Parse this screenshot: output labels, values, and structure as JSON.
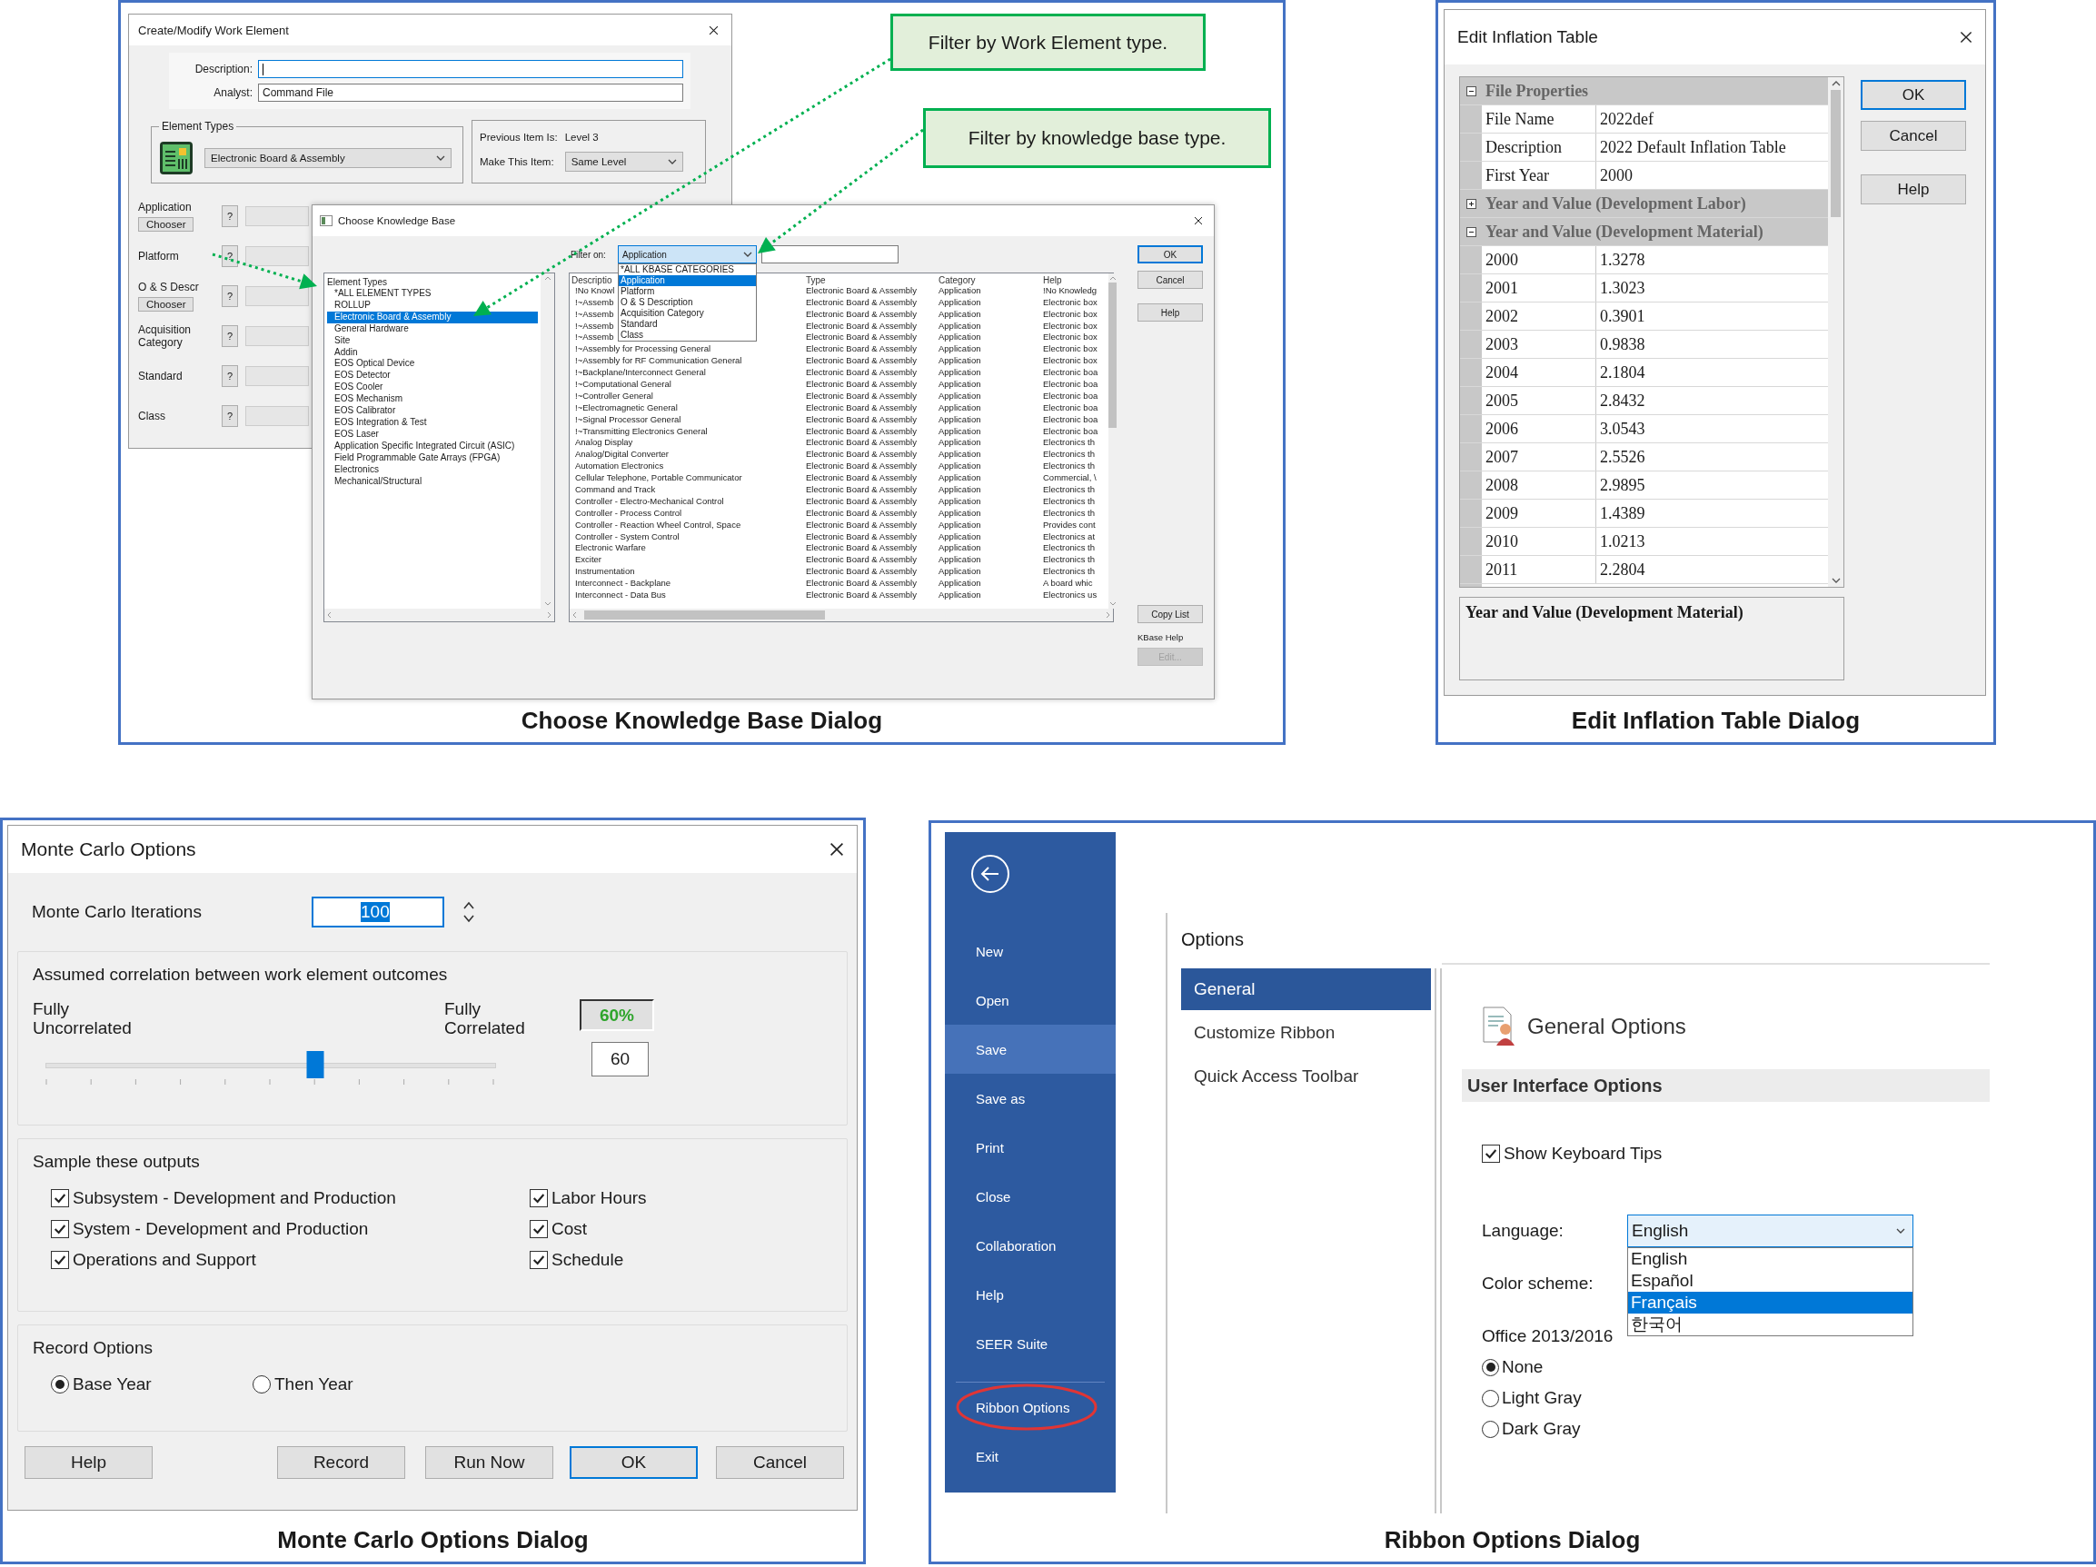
{
  "kb_figure": {
    "work_element_window": {
      "title": "Create/Modify Work Element",
      "description_label": "Description:",
      "analyst_label": "Analyst:",
      "analyst_value": "Command File",
      "element_types_label": "Element Types",
      "element_type": "Electronic Board & Assembly",
      "previous_item_label": "Previous Item Is:",
      "previous_item_value": "Level 3",
      "make_item_label": "Make This Item:",
      "make_item_value": "Same Level",
      "fields": [
        {
          "label": "Application",
          "help_button": "?",
          "chooser_button": "Chooser"
        },
        {
          "label": "Platform",
          "help_button": "?"
        },
        {
          "label": "O & S Descr",
          "help_button": "?",
          "chooser_button": "Chooser"
        },
        {
          "label": "Acquisition Category",
          "help_button": "?"
        },
        {
          "label": "Standard",
          "help_button": "?"
        },
        {
          "label": "Class",
          "help_button": "?"
        }
      ]
    },
    "kb_window": {
      "title": "Choose Knowledge Base",
      "filter_label": "Filter on:",
      "filter_value": "Application",
      "filter_options": [
        {
          "label": "*ALL KBASE CATEGORIES",
          "selected": false
        },
        {
          "label": "Application",
          "selected": true
        },
        {
          "label": "Platform",
          "selected": false
        },
        {
          "label": "O & S Description",
          "selected": false
        },
        {
          "label": "Acquisition Category",
          "selected": false
        },
        {
          "label": "Standard",
          "selected": false
        },
        {
          "label": "Class",
          "selected": false
        }
      ],
      "element_types_header": "Element Types",
      "element_types": [
        {
          "label": "*ALL ELEMENT TYPES",
          "selected": false
        },
        {
          "label": "ROLLUP",
          "selected": false
        },
        {
          "label": "Electronic Board & Assembly",
          "selected": true
        },
        {
          "label": "General Hardware",
          "selected": false
        },
        {
          "label": "Site",
          "selected": false
        },
        {
          "label": "Addin",
          "selected": false
        },
        {
          "label": "EOS Optical Device",
          "selected": false
        },
        {
          "label": "EOS Detector",
          "selected": false
        },
        {
          "label": "EOS Cooler",
          "selected": false
        },
        {
          "label": "EOS Mechanism",
          "selected": false
        },
        {
          "label": "EOS Calibrator",
          "selected": false
        },
        {
          "label": "EOS Integration & Test",
          "selected": false
        },
        {
          "label": "EOS Laser",
          "selected": false
        },
        {
          "label": "Application Specific Integrated Circuit (ASIC)",
          "selected": false
        },
        {
          "label": "Field Programmable Gate Arrays (FPGA)",
          "selected": false
        },
        {
          "label": "Electronics",
          "selected": false
        },
        {
          "label": "Mechanical/Structural",
          "selected": false
        }
      ],
      "columns": [
        "Descriptio",
        "Type",
        "Category",
        "Help"
      ],
      "rows": [
        {
          "description": "!No Knowl",
          "type": "Electronic Board & Assembly",
          "category": "Application",
          "help": "!No Knowledg"
        },
        {
          "description": "!~Assemb",
          "type": "Electronic Board & Assembly",
          "category": "Application",
          "help": "Electronic box"
        },
        {
          "description": "!~Assemb",
          "type": "Electronic Board & Assembly",
          "category": "Application",
          "help": "Electronic box"
        },
        {
          "description": "!~Assemb",
          "type": "Electronic Board & Assembly",
          "category": "Application",
          "help": "Electronic box"
        },
        {
          "description": "!~Assemb",
          "type": "Electronic Board & Assembly",
          "category": "Application",
          "help": "Electronic box"
        },
        {
          "description": "!~Assembly for Processing General",
          "type": "Electronic Board & Assembly",
          "category": "Application",
          "help": "Electronic box"
        },
        {
          "description": "!~Assembly for RF Communication General",
          "type": "Electronic Board & Assembly",
          "category": "Application",
          "help": "Electronic box"
        },
        {
          "description": "!~Backplane/Interconnect General",
          "type": "Electronic Board & Assembly",
          "category": "Application",
          "help": "Electronic boa"
        },
        {
          "description": "!~Computational General",
          "type": "Electronic Board & Assembly",
          "category": "Application",
          "help": "Electronic boa"
        },
        {
          "description": "!~Controller General",
          "type": "Electronic Board & Assembly",
          "category": "Application",
          "help": "Electronic boa"
        },
        {
          "description": "!~Electromagnetic General",
          "type": "Electronic Board & Assembly",
          "category": "Application",
          "help": "Electronic boa"
        },
        {
          "description": "!~Signal Processor General",
          "type": "Electronic Board & Assembly",
          "category": "Application",
          "help": "Electronic boa"
        },
        {
          "description": "!~Transmitting Electronics General",
          "type": "Electronic Board & Assembly",
          "category": "Application",
          "help": "Electronic boa"
        },
        {
          "description": "Analog Display",
          "type": "Electronic Board & Assembly",
          "category": "Application",
          "help": "Electronics th"
        },
        {
          "description": "Analog/Digital Converter",
          "type": "Electronic Board & Assembly",
          "category": "Application",
          "help": "Electronics th"
        },
        {
          "description": "Automation Electronics",
          "type": "Electronic Board & Assembly",
          "category": "Application",
          "help": "Electronics th"
        },
        {
          "description": "Cellular Telephone, Portable Communicator",
          "type": "Electronic Board & Assembly",
          "category": "Application",
          "help": "Commercial, \\"
        },
        {
          "description": "Command and Track",
          "type": "Electronic Board & Assembly",
          "category": "Application",
          "help": "Electronics th"
        },
        {
          "description": "Controller - Electro-Mechanical Control",
          "type": "Electronic Board & Assembly",
          "category": "Application",
          "help": "Electronics th"
        },
        {
          "description": "Controller - Process Control",
          "type": "Electronic Board & Assembly",
          "category": "Application",
          "help": "Electronics th"
        },
        {
          "description": "Controller - Reaction Wheel Control, Space",
          "type": "Electronic Board & Assembly",
          "category": "Application",
          "help": "Provides cont"
        },
        {
          "description": "Controller - System Control",
          "type": "Electronic Board & Assembly",
          "category": "Application",
          "help": "Electronics at"
        },
        {
          "description": "Electronic Warfare",
          "type": "Electronic Board & Assembly",
          "category": "Application",
          "help": "Electronics th"
        },
        {
          "description": "Exciter",
          "type": "Electronic Board & Assembly",
          "category": "Application",
          "help": "Electronics th"
        },
        {
          "description": "Instrumentation",
          "type": "Electronic Board & Assembly",
          "category": "Application",
          "help": "Electronics th"
        },
        {
          "description": "Interconnect - Backplane",
          "type": "Electronic Board & Assembly",
          "category": "Application",
          "help": "A board whic"
        },
        {
          "description": "Interconnect - Data Bus",
          "type": "Electronic Board & Assembly",
          "category": "Application",
          "help": "Electronics us"
        }
      ],
      "buttons": [
        {
          "label": "OK",
          "default": true
        },
        {
          "label": "Cancel",
          "default": false
        },
        {
          "label": "Help",
          "default": false
        }
      ],
      "copy_list_button": "Copy List",
      "kbase_help_label": "KBase Help",
      "edit_button": {
        "label": "Edit...",
        "disabled": true
      }
    },
    "callouts": [
      {
        "text": "Filter by Work Element type."
      },
      {
        "text": "Filter by knowledge base type."
      }
    ],
    "caption": "Choose Knowledge Base Dialog"
  },
  "inflation_figure": {
    "window": {
      "title": "Edit Inflation Table",
      "categories": [
        {
          "label": "File Properties",
          "expanded": true,
          "children": [
            {
              "name": "File Name",
              "value": "2022def"
            },
            {
              "name": "Description",
              "value": "2022 Default Inflation Table"
            },
            {
              "name": "First Year",
              "value": "2000"
            }
          ]
        },
        {
          "label": "Year and Value (Development Labor)",
          "expanded": false
        },
        {
          "label": "Year and Value (Development Material)",
          "expanded": true,
          "children": [
            {
              "name": "2000",
              "value": "1.3278"
            },
            {
              "name": "2001",
              "value": "1.3023"
            },
            {
              "name": "2002",
              "value": "0.3901"
            },
            {
              "name": "2003",
              "value": "0.9838"
            },
            {
              "name": "2004",
              "value": "2.1804"
            },
            {
              "name": "2005",
              "value": "2.8432"
            },
            {
              "name": "2006",
              "value": "3.0543"
            },
            {
              "name": "2007",
              "value": "2.5526"
            },
            {
              "name": "2008",
              "value": "2.9895"
            },
            {
              "name": "2009",
              "value": "1.4389"
            },
            {
              "name": "2010",
              "value": "1.0213"
            },
            {
              "name": "2011",
              "value": "2.2804"
            }
          ]
        }
      ],
      "description_title": "Year and Value (Development Material)",
      "buttons": [
        {
          "label": "OK",
          "default": true
        },
        {
          "label": "Cancel",
          "default": false
        },
        {
          "label": "Help",
          "default": false
        }
      ]
    },
    "caption": "Edit Inflation Table Dialog"
  },
  "monte_carlo_figure": {
    "window": {
      "title": "Monte Carlo Options",
      "iterations_label": "Monte Carlo Iterations",
      "iterations_value": "100",
      "value_selected": true,
      "correlation": {
        "title": "Assumed correlation between work element outcomes",
        "min_label": "Fully Uncorrelated",
        "max_label": "Fully Correlated",
        "percent": "60%",
        "level": 0.6,
        "value": "60"
      },
      "outputs": {
        "title": "Sample these outputs",
        "items": [
          {
            "label": "Subsystem - Development and Production",
            "checked": true
          },
          {
            "label": "Labor Hours",
            "checked": true
          },
          {
            "label": "System - Development and Production",
            "checked": true
          },
          {
            "label": "Cost",
            "checked": true
          },
          {
            "label": "Operations and Support",
            "checked": true
          },
          {
            "label": "Schedule",
            "checked": true
          }
        ]
      },
      "record": {
        "title": "Record Options",
        "options": [
          {
            "label": "Base Year",
            "selected": true
          },
          {
            "label": "Then Year",
            "selected": false
          }
        ]
      },
      "buttons": [
        {
          "label": "Help",
          "default": false
        },
        {
          "label": "Record",
          "default": false
        },
        {
          "label": "Run Now",
          "default": false
        },
        {
          "label": "OK",
          "default": true
        },
        {
          "label": "Cancel",
          "default": false
        }
      ]
    },
    "caption": "Monte Carlo Options Dialog"
  },
  "ribbon_figure": {
    "backstage": {
      "items": [
        {
          "label": "New",
          "selected": false
        },
        {
          "label": "Open",
          "selected": false
        },
        {
          "label": "Save",
          "selected": true
        },
        {
          "label": "Save as",
          "selected": false
        },
        {
          "label": "Print",
          "selected": false
        },
        {
          "label": "Close",
          "selected": false
        },
        {
          "label": "Collaboration",
          "selected": false
        },
        {
          "label": "Help",
          "selected": false
        },
        {
          "label": "SEER Suite",
          "selected": false
        }
      ],
      "lower_items": [
        {
          "label": "Ribbon Options",
          "selected": false,
          "circled": true
        },
        {
          "label": "Exit",
          "selected": false,
          "circled": false
        }
      ]
    },
    "options_window": {
      "title": "Options",
      "nav": [
        {
          "label": "General",
          "selected": true
        },
        {
          "label": "Customize Ribbon",
          "selected": false
        },
        {
          "label": "Quick Access Toolbar",
          "selected": false
        }
      ],
      "heading": "General Options",
      "section": "User Interface Options",
      "keyboard_tips": {
        "label": "Show Keyboard Tips",
        "checked": true
      },
      "language_label": "Language:",
      "language_value": "English",
      "language_options": [
        {
          "label": "English",
          "selected": false
        },
        {
          "label": "Español",
          "selected": false
        },
        {
          "label": "Français",
          "selected": true
        },
        {
          "label": "한국어",
          "selected": false
        }
      ],
      "color_scheme_label": "Color scheme:",
      "background_label": "Office 2013/2016",
      "background_options": [
        {
          "label": "None",
          "selected": true
        },
        {
          "label": "Light Gray",
          "selected": false
        },
        {
          "label": "Dark Gray",
          "selected": false
        }
      ]
    },
    "caption": "Ribbon Options Dialog"
  }
}
